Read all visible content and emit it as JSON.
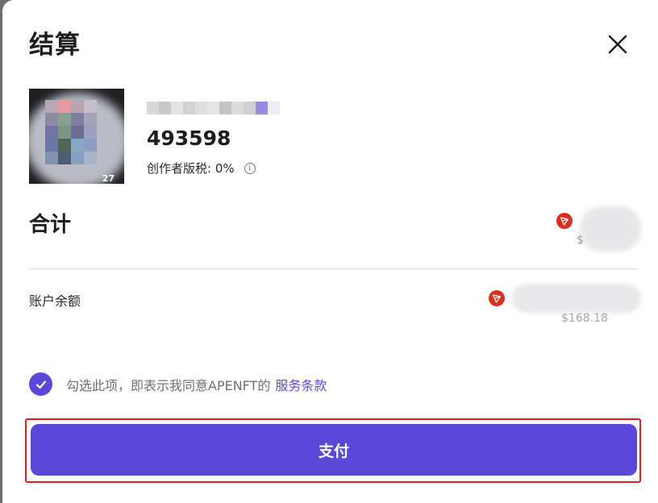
{
  "dialog": {
    "title": "结算",
    "close_icon": "close-icon"
  },
  "nft": {
    "number": "493598",
    "thumbnail_badge": "27",
    "royalty_label": "创作者版税: 0%",
    "info_icon": "info-icon"
  },
  "summary": {
    "total_label": "合计",
    "total_currency_icon": "trx-icon",
    "total_usd_prefix": "$",
    "balance_label": "账户余额",
    "balance_currency_icon": "trx-icon",
    "balance_usd": "$168.18"
  },
  "agreement": {
    "checked": true,
    "text": "勾选此项，即表示我同意APENFT的",
    "link": "服务条款"
  },
  "pay_button": {
    "label": "支付"
  },
  "colors": {
    "accent": "#5b48d9",
    "trx_red": "#d7301f",
    "highlight_outline": "#e21d1d"
  }
}
